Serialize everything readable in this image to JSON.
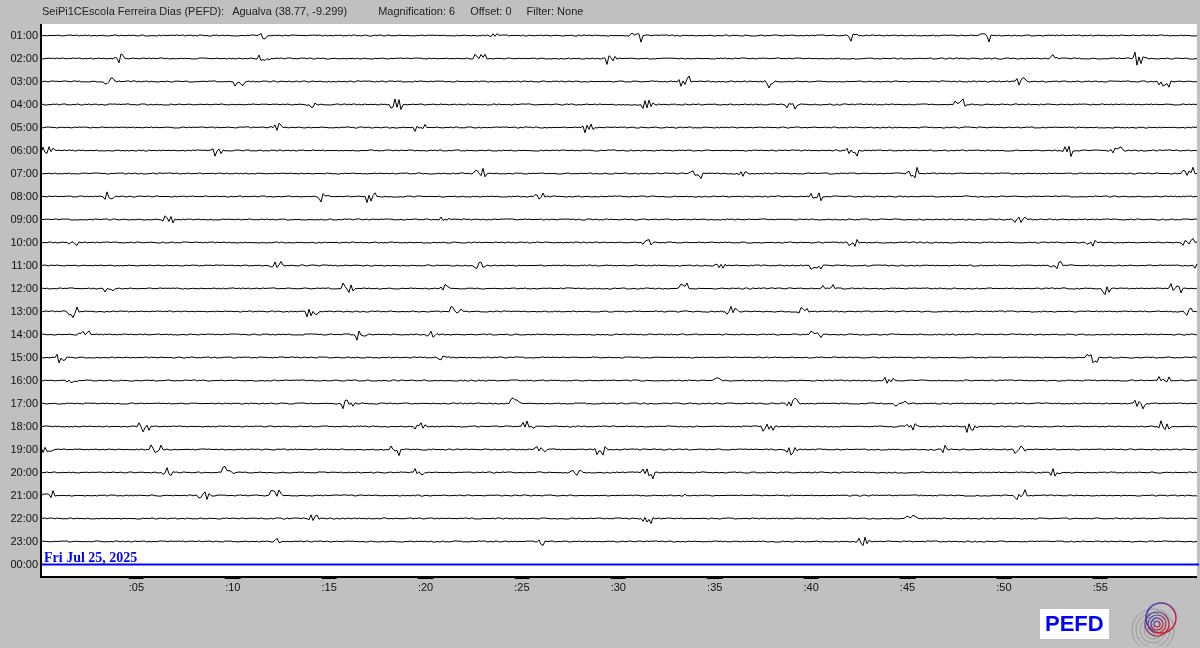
{
  "header": {
    "station": "SeiPi1CEscola Ferreira Dias (PEFD):",
    "location": "Agualva (38.77, -9.299)",
    "magnification": "Magnification: 6",
    "offset": "Offset: 0",
    "filter": "Filter: None"
  },
  "rows": [
    {
      "label": "01:00",
      "current": false
    },
    {
      "label": "02:00",
      "current": false
    },
    {
      "label": "03:00",
      "current": false
    },
    {
      "label": "04:00",
      "current": false
    },
    {
      "label": "05:00",
      "current": false
    },
    {
      "label": "06:00",
      "current": false
    },
    {
      "label": "07:00",
      "current": false
    },
    {
      "label": "08:00",
      "current": false
    },
    {
      "label": "09:00",
      "current": false
    },
    {
      "label": "10:00",
      "current": false
    },
    {
      "label": "11:00",
      "current": false
    },
    {
      "label": "12:00",
      "current": false
    },
    {
      "label": "13:00",
      "current": false
    },
    {
      "label": "14:00",
      "current": false
    },
    {
      "label": "15:00",
      "current": false
    },
    {
      "label": "16:00",
      "current": false
    },
    {
      "label": "17:00",
      "current": false
    },
    {
      "label": "18:00",
      "current": false
    },
    {
      "label": "19:00",
      "current": false
    },
    {
      "label": "20:00",
      "current": false
    },
    {
      "label": "21:00",
      "current": false
    },
    {
      "label": "22:00",
      "current": false
    },
    {
      "label": "23:00",
      "current": false
    },
    {
      "label": "00:00",
      "current": true
    }
  ],
  "date": "Fri Jul 25, 2025",
  "x_ticks": [
    ":05",
    ":10",
    ":15",
    ":20",
    ":25",
    ":30",
    ":35",
    ":40",
    ":45",
    ":50",
    ":55"
  ],
  "station_code": "PEFD"
}
